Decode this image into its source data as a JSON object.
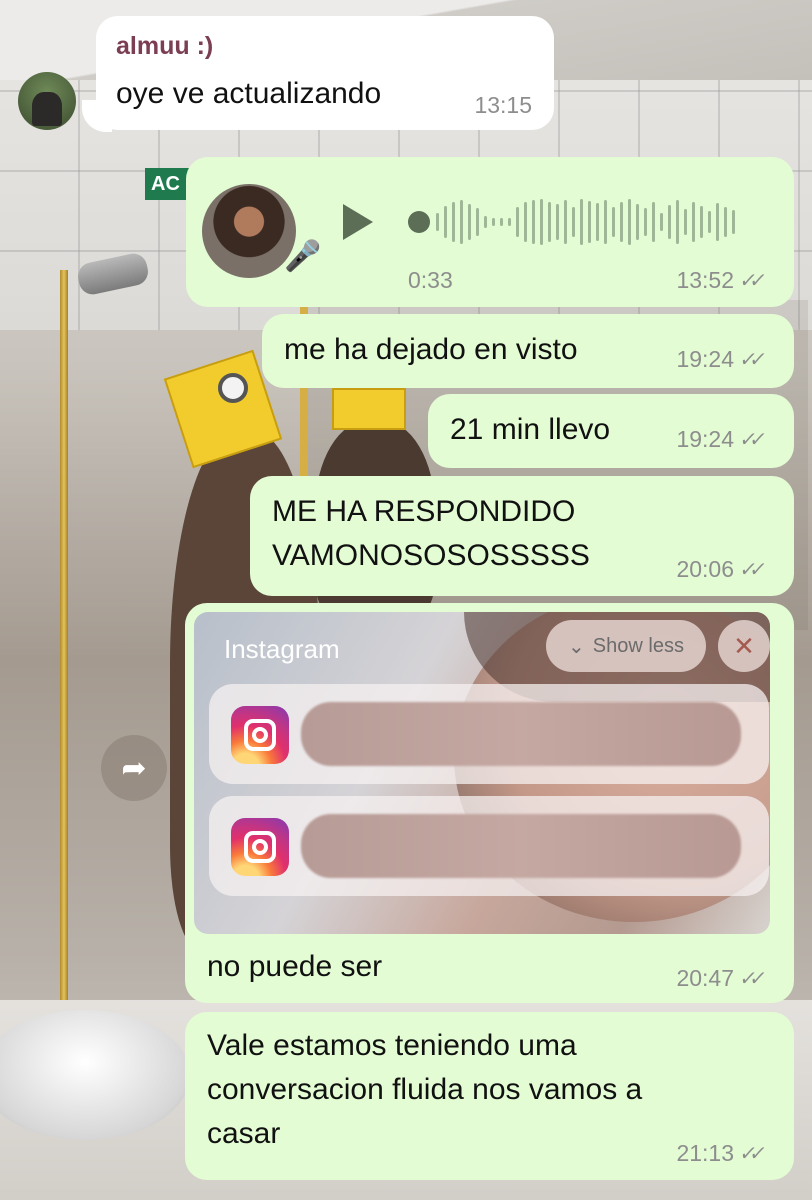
{
  "chat": {
    "incoming": {
      "sender": "almuu :)",
      "text": "oye ve actualizando",
      "time": "13:15"
    },
    "voice_note": {
      "duration": "0:33",
      "time": "13:52"
    },
    "messages": [
      {
        "text": "me ha dejado en visto",
        "time": "19:24"
      },
      {
        "text": "21 min llevo",
        "time": "19:24"
      },
      {
        "text": "ME HA RESPONDIDO\nVAMONOSOSOSSSSS",
        "time": "20:06"
      }
    ],
    "screenshot_message": {
      "caption": "no puede ser",
      "time": "20:47",
      "notification_app": "Instagram",
      "show_less_label": "Show less"
    },
    "last_message": {
      "text": "Vale estamos teniendo uma\nconversacion fluida nos vamos a\ncasar",
      "time": "21:13"
    }
  },
  "wallpaper": {
    "sign_text": "AC"
  },
  "colors": {
    "outgoing_bubble": "#e3fcd4",
    "incoming_bubble": "#ffffff",
    "sender_name": "#7b3e53"
  }
}
